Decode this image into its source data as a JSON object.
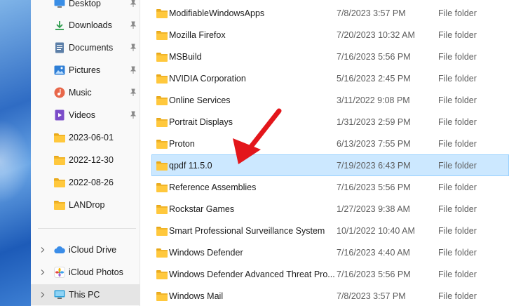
{
  "nav": {
    "items": [
      {
        "label": "Desktop",
        "icon": "desktop-icon",
        "pinned": true
      },
      {
        "label": "Downloads",
        "icon": "download-icon",
        "pinned": true
      },
      {
        "label": "Documents",
        "icon": "document-icon",
        "pinned": true
      },
      {
        "label": "Pictures",
        "icon": "pictures-icon",
        "pinned": true
      },
      {
        "label": "Music",
        "icon": "music-icon",
        "pinned": true
      },
      {
        "label": "Videos",
        "icon": "videos-icon",
        "pinned": true
      },
      {
        "label": "2023-06-01",
        "icon": "folder-icon",
        "pinned": false
      },
      {
        "label": "2022-12-30",
        "icon": "folder-icon",
        "pinned": false
      },
      {
        "label": "2022-08-26",
        "icon": "folder-icon",
        "pinned": false
      },
      {
        "label": "LANDrop",
        "icon": "folder-icon",
        "pinned": false
      }
    ],
    "locations": [
      {
        "label": "iCloud Drive",
        "icon": "icloud-drive-icon"
      },
      {
        "label": "iCloud Photos",
        "icon": "icloud-photos-icon"
      },
      {
        "label": "This PC",
        "icon": "this-pc-icon",
        "selected": true
      }
    ]
  },
  "files": [
    {
      "name": "ModifiableWindowsApps",
      "date": "7/8/2023 3:57 PM",
      "type": "File folder"
    },
    {
      "name": "Mozilla Firefox",
      "date": "7/20/2023 10:32 AM",
      "type": "File folder"
    },
    {
      "name": "MSBuild",
      "date": "7/16/2023 5:56 PM",
      "type": "File folder"
    },
    {
      "name": "NVIDIA Corporation",
      "date": "5/16/2023 2:45 PM",
      "type": "File folder"
    },
    {
      "name": "Online Services",
      "date": "3/11/2022 9:08 PM",
      "type": "File folder"
    },
    {
      "name": "Portrait Displays",
      "date": "1/31/2023 2:59 PM",
      "type": "File folder"
    },
    {
      "name": "Proton",
      "date": "6/13/2023 7:55 PM",
      "type": "File folder"
    },
    {
      "name": "qpdf 11.5.0",
      "date": "7/19/2023 6:43 PM",
      "type": "File folder",
      "selected": true
    },
    {
      "name": "Reference Assemblies",
      "date": "7/16/2023 5:56 PM",
      "type": "File folder"
    },
    {
      "name": "Rockstar Games",
      "date": "1/27/2023 9:38 AM",
      "type": "File folder"
    },
    {
      "name": "Smart Professional Surveillance System",
      "date": "10/1/2022 10:40 AM",
      "type": "File folder"
    },
    {
      "name": "Windows Defender",
      "date": "7/16/2023 4:40 AM",
      "type": "File folder"
    },
    {
      "name": "Windows Defender Advanced Threat Pro...",
      "date": "7/16/2023 5:56 PM",
      "type": "File folder"
    },
    {
      "name": "Windows Mail",
      "date": "7/8/2023 3:57 PM",
      "type": "File folder"
    }
  ],
  "colors": {
    "selection": "#cce8ff",
    "annotation_arrow": "#e3161b",
    "folder": "#ffc83d"
  }
}
